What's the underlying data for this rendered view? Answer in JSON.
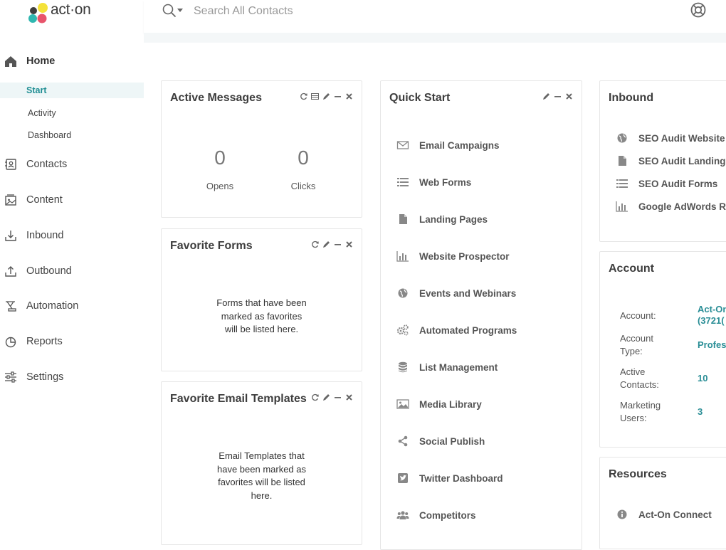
{
  "brand": {
    "name": "act·on"
  },
  "search": {
    "placeholder": "Search All Contacts"
  },
  "sidebar": {
    "items": [
      {
        "label": "Home"
      },
      {
        "label": "Contacts"
      },
      {
        "label": "Content"
      },
      {
        "label": "Inbound"
      },
      {
        "label": "Outbound"
      },
      {
        "label": "Automation"
      },
      {
        "label": "Reports"
      },
      {
        "label": "Settings"
      }
    ],
    "home_sub": [
      {
        "label": "Start"
      },
      {
        "label": "Activity"
      },
      {
        "label": "Dashboard"
      }
    ]
  },
  "active_messages": {
    "title": "Active Messages",
    "opens_value": "0",
    "opens_label": "Opens",
    "clicks_value": "0",
    "clicks_label": "Clicks"
  },
  "favorite_forms": {
    "title": "Favorite Forms",
    "line1": "Forms that have been",
    "line2": "marked as favorites",
    "line3": "will be listed here."
  },
  "favorite_templates": {
    "title": "Favorite Email Templates",
    "line1": "Email Templates that",
    "line2": "have been marked as",
    "line3": "favorites will be listed",
    "line4": "here."
  },
  "quick_start": {
    "title": "Quick Start",
    "links": [
      {
        "label": "Email Campaigns",
        "icon": "envelope-icon"
      },
      {
        "label": "Web Forms",
        "icon": "list-icon"
      },
      {
        "label": "Landing Pages",
        "icon": "document-icon"
      },
      {
        "label": "Website Prospector",
        "icon": "bar-chart-icon"
      },
      {
        "label": "Events and Webinars",
        "icon": "globe-icon"
      },
      {
        "label": "Automated Programs",
        "icon": "gears-icon"
      },
      {
        "label": "List Management",
        "icon": "database-icon"
      },
      {
        "label": "Media Library",
        "icon": "image-icon"
      },
      {
        "label": "Social Publish",
        "icon": "share-icon"
      },
      {
        "label": "Twitter Dashboard",
        "icon": "twitter-icon"
      },
      {
        "label": "Competitors",
        "icon": "users-icon"
      }
    ]
  },
  "inbound": {
    "title": "Inbound",
    "links": [
      {
        "label": "SEO Audit Website",
        "icon": "globe-icon"
      },
      {
        "label": "SEO Audit Landing",
        "icon": "document-icon"
      },
      {
        "label": "SEO Audit Forms",
        "icon": "list-icon"
      },
      {
        "label": "Google AdWords R",
        "icon": "bar-chart-icon"
      }
    ]
  },
  "account": {
    "title": "Account",
    "account_label": "Account:",
    "account_value_1": "Act-On",
    "account_value_2": "(3721(",
    "type_label_1": "Account",
    "type_label_2": "Type:",
    "type_value": "Profes",
    "contacts_label_1": "Active",
    "contacts_label_2": "Contacts:",
    "contacts_value": "10",
    "users_label_1": "Marketing",
    "users_label_2": "Users:",
    "users_value": "3"
  },
  "resources": {
    "title": "Resources",
    "links": [
      {
        "label": "Act-On Connect",
        "icon": "info-icon"
      }
    ]
  }
}
